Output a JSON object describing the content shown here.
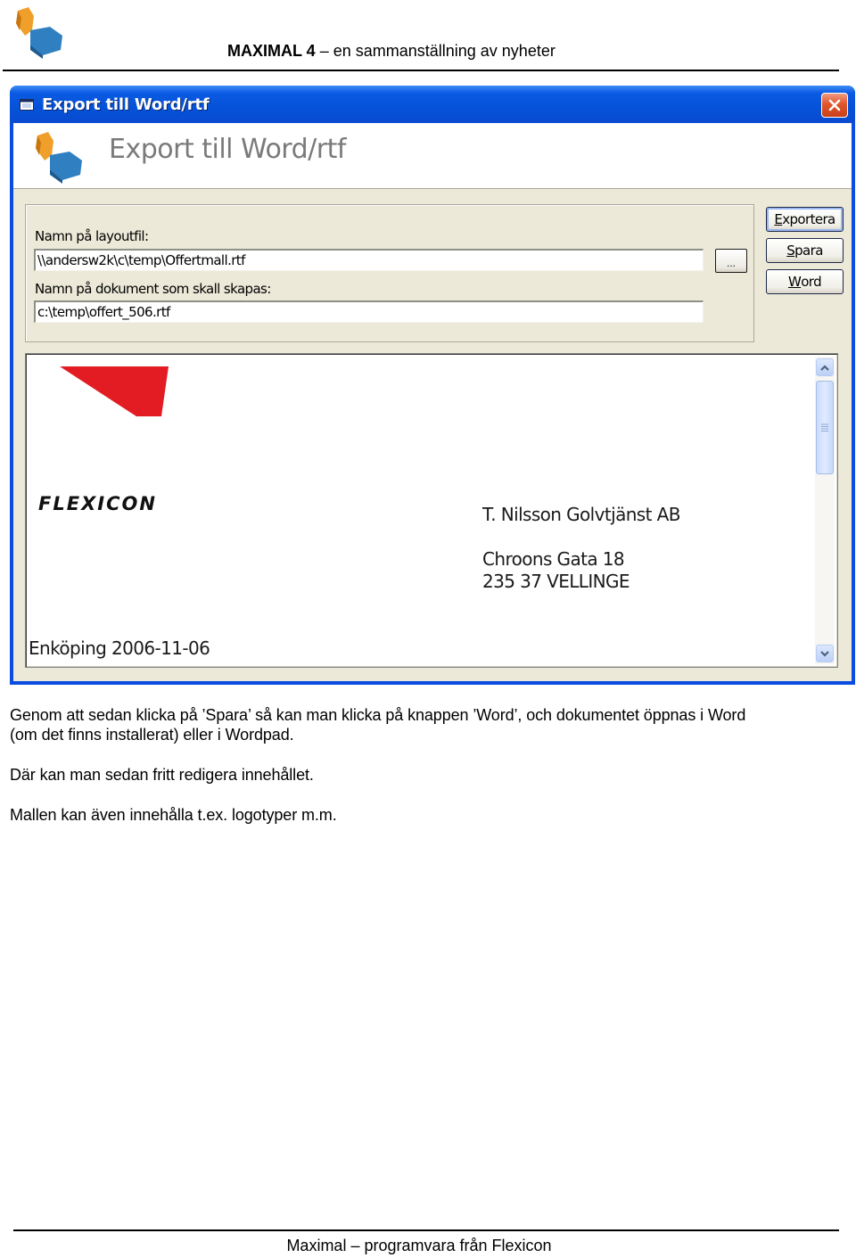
{
  "page_header": {
    "title_bold": "MAXIMAL 4",
    "title_rest": " – en sammanställning av nyheter",
    "logo_icon": "maximal-puzzle-logo"
  },
  "dialog": {
    "window_title": "Export till Word/rtf",
    "banner_title": "Export till Word/rtf",
    "close_icon": "close-icon",
    "fields": {
      "layout_file_label": "Namn på layoutfil:",
      "layout_file_value": "\\\\andersw2k\\c\\temp\\Offertmall.rtf",
      "browse_label": "...",
      "document_label": "Namn på dokument som skall skapas:",
      "document_value": "c:\\temp\\offert_506.rtf"
    },
    "buttons": {
      "export": {
        "mnemonic": "E",
        "rest": "xportera"
      },
      "save": {
        "mnemonic": "S",
        "rest": "para"
      },
      "word": {
        "mnemonic": "W",
        "rest": "ord"
      }
    },
    "preview": {
      "logo_text": "FLEXICON",
      "recipient_company": "T. Nilsson Golvtjänst AB",
      "address_street": "Chroons Gata 18",
      "address_city": "235 37  VELLINGE",
      "place_date": "Enköping  2006-11-06"
    },
    "colors": {
      "titlebar": "#0552d8",
      "dialog_face": "#ece9d8",
      "logo_red": "#e31b23"
    }
  },
  "body": {
    "paragraph1_line1": "Genom att sedan klicka på ’Spara’ så kan man klicka på knappen ’Word’, och dokumentet öppnas i Word",
    "paragraph1_line2": "(om det finns installerat) eller i Wordpad.",
    "paragraph2": "Där kan man sedan fritt redigera innehållet.",
    "paragraph3": "Mallen kan även innehålla t.ex. logotyper m.m."
  },
  "footer": {
    "text": "Maximal – programvara från Flexicon"
  }
}
